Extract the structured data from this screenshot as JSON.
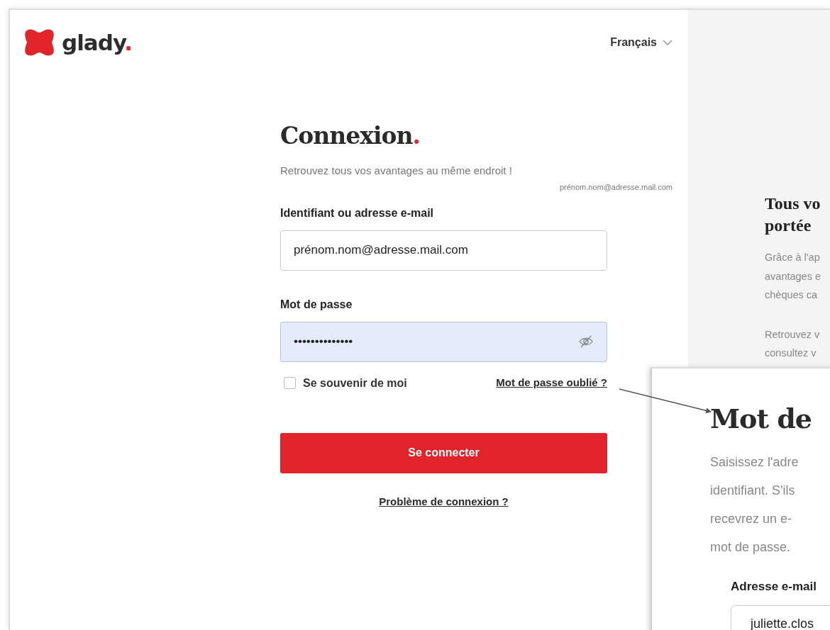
{
  "logo": {
    "text": "glady",
    "dot": "."
  },
  "language": {
    "label": "Français"
  },
  "login": {
    "title": "Connexion",
    "title_dot": ".",
    "subtitle": "Retrouvez tous vos avantages au même endroit !",
    "autofill_hint": "prénom.nom@adresse.mail.com",
    "fields": [
      {
        "kind": "text",
        "label": "Identifiant ou adresse e-mail",
        "value": "prénom.nom@adresse.mail.com",
        "autofilled": false
      },
      {
        "kind": "password",
        "label": "Mot de passe",
        "value": "••••••••••••••",
        "autofilled": true
      }
    ],
    "remember": {
      "label": "Se souvenir de moi",
      "checked": false
    },
    "forgot_link": "Mot de passe oublié ?",
    "submit": "Se connecter",
    "help_link": "Problème de connexion ?"
  },
  "promo": {
    "title_lines": [
      "Tous vo",
      "portée"
    ],
    "paragraphs": [
      [
        "Grâce à l'ap",
        "avantages e",
        "chèques ca"
      ],
      [
        "Retrouvez v",
        "consultez v"
      ]
    ]
  },
  "reset_inset": {
    "title": "Mot de",
    "description_lines": [
      "Saisissez l'adre",
      "identifiant. S'ils",
      "recevrez un e-",
      "mot de passe."
    ],
    "email_label": "Adresse e-mail",
    "email_value": "juliette.clos"
  }
}
